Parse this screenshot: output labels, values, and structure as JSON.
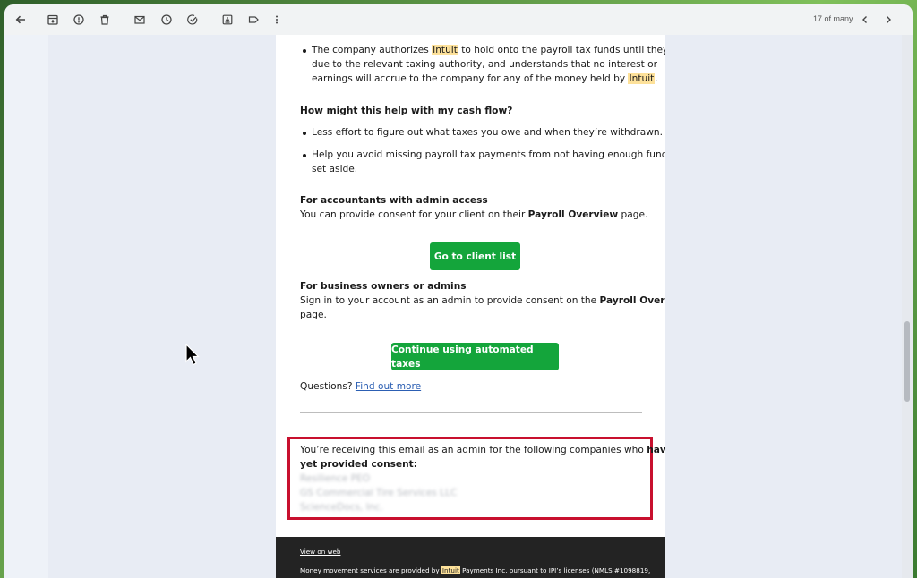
{
  "toolbar": {
    "pager_text": "17 of many",
    "icons": [
      "back-arrow-icon",
      "archive-icon",
      "report-spam-icon",
      "delete-icon",
      "mark-unread-icon",
      "snooze-icon",
      "add-to-tasks-icon",
      "move-to-icon",
      "label-icon",
      "more-options-icon",
      "older-chevron-icon",
      "newer-chevron-icon"
    ]
  },
  "email": {
    "bullet1": {
      "line1_a": "The company authorizes ",
      "line1_hl": "Intuit",
      "line1_b": " to hold onto the payroll tax funds until they are",
      "line2": "due to the relevant taxing authority, and understands that no interest or",
      "line3_a": "earnings will accrue to the company for any of the money held by ",
      "line3_hl": "Intuit",
      "line3_b": "."
    },
    "cashflow_heading": "How might this help with my cash flow?",
    "cashflow_bullet1": "Less effort to figure out what taxes you owe and when they’re withdrawn.",
    "cashflow_bullet2_line1": "Help you avoid missing payroll tax payments from not having enough funds",
    "cashflow_bullet2_line2": "set aside.",
    "accountants_heading": "For accountants with admin access",
    "accountants_text_a": "You can provide consent for your client on their ",
    "accountants_text_bold": "Payroll Overview",
    "accountants_text_b": " page.",
    "client_list_button": "Go to client list",
    "owners_heading": "For business owners or admins",
    "owners_line1_a": "Sign in to your account as an admin to provide consent on the ",
    "owners_line1_bold": "Payroll Overview",
    "owners_line2": "page.",
    "continue_button": "Continue using automated taxes",
    "questions_text": "Questions? ",
    "find_out_more": "Find out more",
    "notice_line1_a": "You’re receiving this email as an admin for the following companies who ",
    "notice_line1_bold": "haven’t",
    "notice_line2_bold": "yet provided consent:",
    "blurred_companies": [
      "Resilience PEO",
      "GS Commercial Tire Services LLC",
      "ScienceDocs, Inc."
    ],
    "footer": {
      "view_on_web": "View on web",
      "line_a": "Money movement services are provided by ",
      "line_hl": "Intuit",
      "line_b": " Payments Inc. pursuant to IPI’s licenses (NMLS #1098819,"
    }
  },
  "colors": {
    "accent_green": "#14a53b",
    "highlight": "#fde19a",
    "callout_red": "#c8102e",
    "link": "#2c5fb3",
    "footer_bg": "#232323"
  }
}
